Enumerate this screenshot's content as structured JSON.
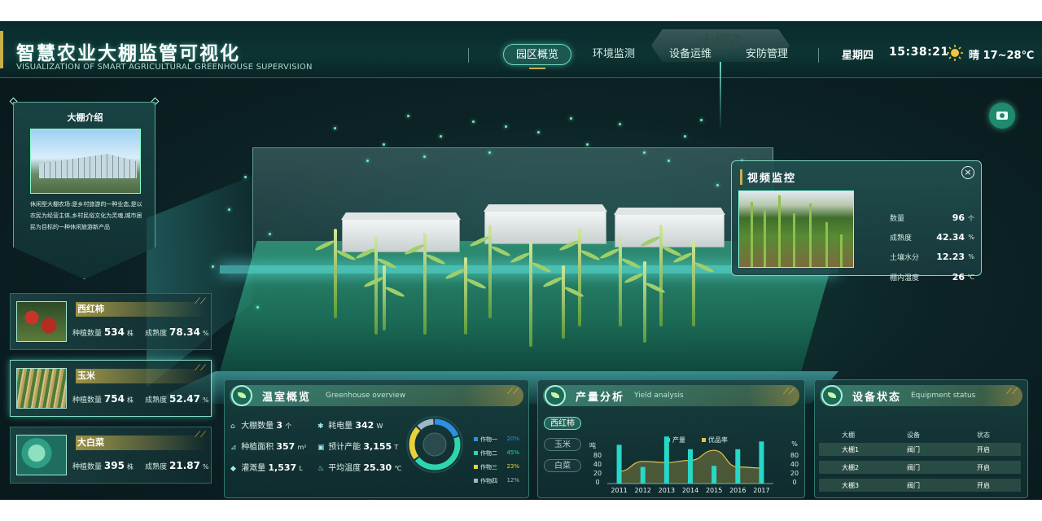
{
  "header": {
    "title": "智慧农业大棚监管可视化",
    "subtitle": "VISUALIZATION OF SMART AGRICULTURAL GREENHOUSE SUPERVISION",
    "nav": [
      "园区概览",
      "环境监测",
      "设备运维",
      "安防管理"
    ],
    "active_nav": "园区概览",
    "day": "星期四",
    "time": "15:38:21",
    "weather_icon": "sun-icon",
    "weather": "晴 17~28℃",
    "greenhouse_label": "大棚2"
  },
  "intro": {
    "title": "大棚介绍",
    "text": "休闲型大棚农场:是乡村旅游的一种业态,是以农民为经营主体,乡村民俗文化为灵魂,城市居民为目标的一种休闲旅游新产品"
  },
  "crops": [
    {
      "name": "西红柿",
      "count_label": "种植数量",
      "count": "534",
      "count_unit": "株",
      "maturity_label": "成熟度",
      "maturity": "78.34",
      "maturity_unit": "%"
    },
    {
      "name": "玉米",
      "count_label": "种植数量",
      "count": "754",
      "count_unit": "株",
      "maturity_label": "成熟度",
      "maturity": "52.47",
      "maturity_unit": "%"
    },
    {
      "name": "大白菜",
      "count_label": "种植数量",
      "count": "395",
      "count_unit": "株",
      "maturity_label": "成熟度",
      "maturity": "21.87",
      "maturity_unit": "%"
    }
  ],
  "video": {
    "title": "视频监控",
    "stats": [
      {
        "label": "数量",
        "value": "96",
        "unit": "个"
      },
      {
        "label": "成熟度",
        "value": "42.34",
        "unit": "%"
      },
      {
        "label": "土壤水分",
        "value": "12.23",
        "unit": "%"
      },
      {
        "label": "棚内温度",
        "value": "26",
        "unit": "℃"
      }
    ]
  },
  "greenhouse_overview": {
    "title": "温室概览",
    "subtitle": "Greenhouse overview",
    "items": [
      {
        "icon": "greenhouse-icon",
        "label": "大棚数量",
        "value": "3",
        "unit": "个"
      },
      {
        "icon": "power-icon",
        "label": "耗电量",
        "value": "342",
        "unit": "W"
      },
      {
        "icon": "area-icon",
        "label": "种植面积",
        "value": "357",
        "unit": "m²"
      },
      {
        "icon": "yield-icon",
        "label": "预计产能",
        "value": "3,155",
        "unit": "T"
      },
      {
        "icon": "water-icon",
        "label": "灌溉量",
        "value": "1,537",
        "unit": "L"
      },
      {
        "icon": "temperature-icon",
        "label": "平均温度",
        "value": "25.30",
        "unit": "℃"
      }
    ],
    "donut": [
      {
        "name": "作物一",
        "percent": "20%",
        "color": "#2f8fe0"
      },
      {
        "name": "作物二",
        "percent": "45%",
        "color": "#2ed6b0"
      },
      {
        "name": "作物三",
        "percent": "23%",
        "color": "#e6d23a"
      },
      {
        "name": "作物四",
        "percent": "12%",
        "color": "#9fb8c8"
      }
    ]
  },
  "yield_analysis": {
    "title": "产量分析",
    "subtitle": "Yield analysis",
    "tabs": [
      "西红柿",
      "玉米",
      "白菜"
    ],
    "active_tab": "西红柿"
  },
  "chart_data": {
    "type": "bar",
    "categories": [
      "2011",
      "2012",
      "2013",
      "2014",
      "2015",
      "2016",
      "2017"
    ],
    "series": [
      {
        "name": "产量",
        "type": "bar",
        "values": [
          70,
          30,
          85,
          62,
          32,
          62,
          76
        ],
        "color": "#27d8c8"
      },
      {
        "name": "优品率",
        "type": "area",
        "values": [
          22,
          40,
          38,
          42,
          60,
          30,
          28
        ],
        "color": "#e6c44a"
      }
    ],
    "ylabel": "吨",
    "y2label": "%",
    "y_ticks": [
      "80",
      "40",
      "20",
      "0"
    ],
    "y2_ticks": [
      "80",
      "40",
      "20",
      "0"
    ],
    "ylim": [
      0,
      100
    ]
  },
  "equipment": {
    "title": "设备状态",
    "subtitle": "Equipment status",
    "columns": [
      "大棚",
      "设备",
      "状态"
    ],
    "rows": [
      [
        "大棚1",
        "阀门",
        "开启"
      ],
      [
        "大棚2",
        "阀门",
        "开启"
      ],
      [
        "大棚3",
        "阀门",
        "开启"
      ]
    ]
  }
}
